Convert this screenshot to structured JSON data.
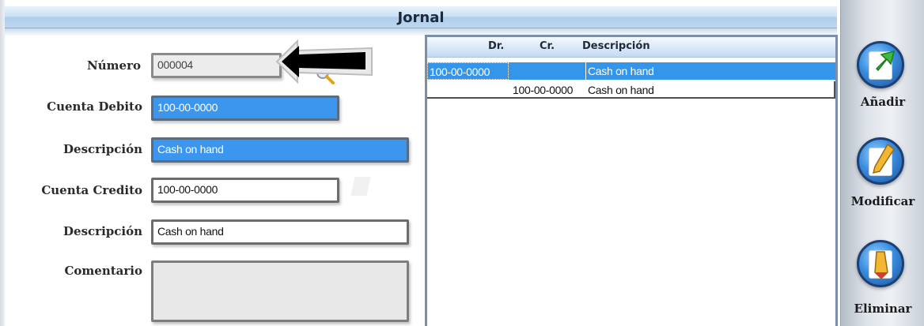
{
  "window": {
    "title": "Jornal"
  },
  "form": {
    "numero": {
      "label": "Número",
      "value": "000004"
    },
    "cuenta_debito": {
      "label": "Cuenta Debito",
      "value": "100-00-0000"
    },
    "descripcion_debito": {
      "label": "Descripción",
      "value": "Cash on hand"
    },
    "cuenta_credito": {
      "label": "Cuenta Credito",
      "value": "100-00-0000"
    },
    "descripcion_credito": {
      "label": "Descripción",
      "value": "Cash on hand"
    },
    "comentario": {
      "label": "Comentario",
      "value": ""
    }
  },
  "grid": {
    "columns": [
      "Dr.",
      "Cr.",
      "Descripción"
    ],
    "rows": [
      {
        "dr": "100-00-0000",
        "cr": "",
        "descripcion": "Cash on hand",
        "selected": true
      },
      {
        "dr": "",
        "cr": "100-00-0000",
        "descripcion": "Cash on hand",
        "selected": false
      }
    ]
  },
  "toolbar": {
    "add": {
      "label": "Añadir",
      "icon": "add-icon"
    },
    "edit": {
      "label": "Modificar",
      "icon": "edit-icon"
    },
    "delete": {
      "label": "Eliminar",
      "icon": "delete-icon"
    }
  },
  "colors": {
    "selection": "#3396ea",
    "field_highlight": "#3c96ee",
    "header_gradient_top": "#e9f3fc",
    "header_gradient_bottom": "#aecdeb",
    "icon_blue": "#3b8fe0"
  }
}
